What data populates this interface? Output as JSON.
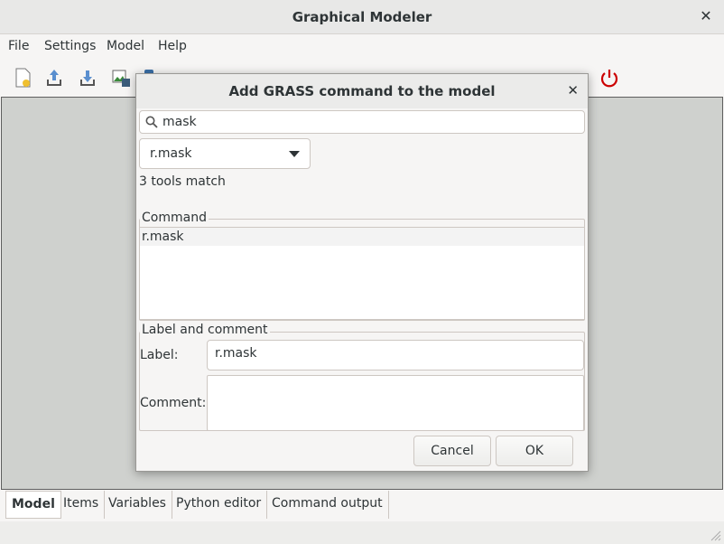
{
  "window": {
    "title": "Graphical Modeler",
    "close_glyph": "✕"
  },
  "menubar": {
    "items": [
      "File",
      "Settings",
      "Model",
      "Help"
    ]
  },
  "toolbar": {
    "icons": [
      "new-model-icon",
      "load-model-icon",
      "save-model-icon",
      "export-image-icon",
      "python-icon",
      "add-data-icon",
      "add-command-icon",
      "add-loop-icon",
      "add-condition-icon",
      "add-comment-icon",
      "run-icon",
      "validate-icon",
      "variables-icon",
      "settings-icon",
      "help-icon",
      "quit-icon"
    ]
  },
  "bottom_tabs": [
    "Model",
    "Items",
    "Variables",
    "Python editor",
    "Command output"
  ],
  "dialog": {
    "title": "Add GRASS command to the model",
    "close_glyph": "✕",
    "search": {
      "value": "mask",
      "icon": "search-icon"
    },
    "combo": {
      "value": "r.mask"
    },
    "match_text": "3 tools match",
    "command_group": {
      "label": "Command",
      "value": "r.mask"
    },
    "label_group": {
      "label": "Label and comment",
      "label_caption": "Label:",
      "label_value": "r.mask",
      "comment_caption": "Comment:",
      "comment_value": ""
    },
    "buttons": {
      "cancel": "Cancel",
      "ok": "OK"
    }
  },
  "colors": {
    "canvas": "#cfd1ce",
    "quit_icon": "#cc0000"
  }
}
